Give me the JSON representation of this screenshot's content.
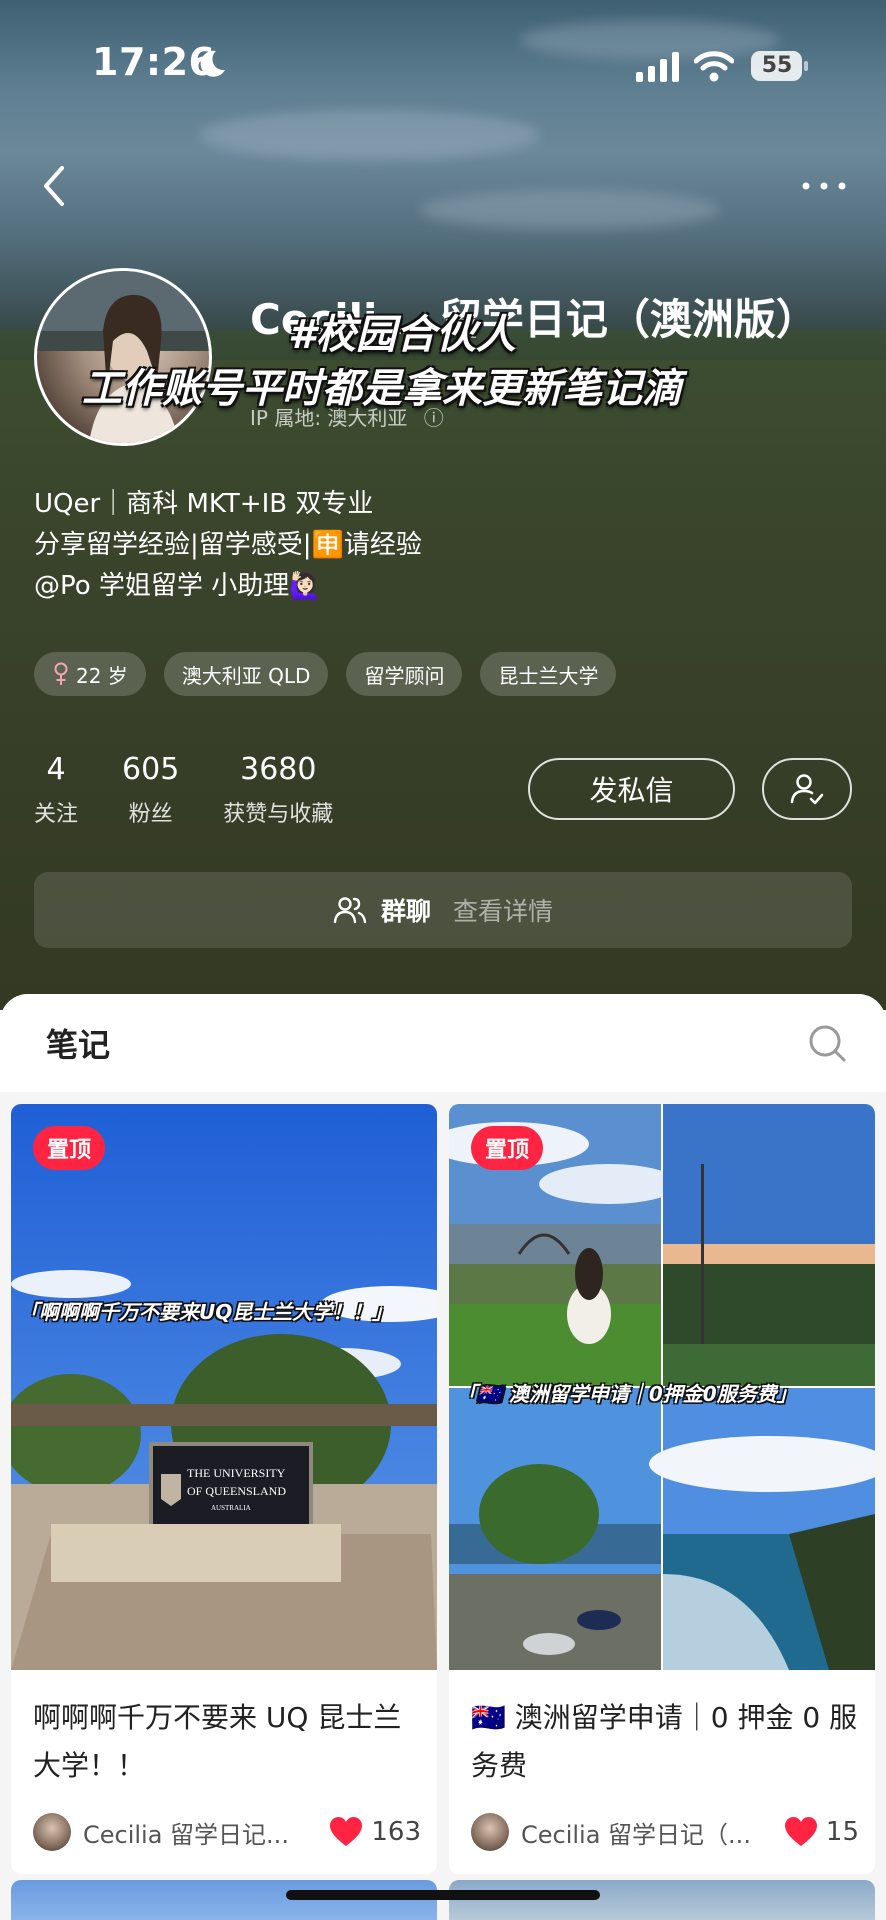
{
  "status_bar": {
    "time": "17:26",
    "battery": "55"
  },
  "profile": {
    "name": "Cecili... 留学日记（澳洲版）",
    "ip_location": "IP 属地: 澳大利亚",
    "overlay_line1": "#校园合伙人",
    "overlay_line2": "工作账号平时都是拿来更新笔记滴",
    "bio": [
      "UQer｜商科 MKT+IB 双专业",
      "分享留学经验|留学感受|🈸请经验",
      "@Po 学姐留学 小助理🙋🏻‍♀️"
    ],
    "tags": [
      {
        "label": "22 岁",
        "icon": "female-icon"
      },
      {
        "label": "澳大利亚 QLD"
      },
      {
        "label": "留学顾问"
      },
      {
        "label": "昆士兰大学"
      }
    ],
    "stats": [
      {
        "value": "4",
        "label": "关注"
      },
      {
        "value": "605",
        "label": "粉丝"
      },
      {
        "value": "3680",
        "label": "获赞与收藏"
      }
    ],
    "message_button": "发私信",
    "group_chat": {
      "label": "群聊",
      "detail": "查看详情"
    }
  },
  "notes": {
    "tab": "笔记",
    "cards": [
      {
        "pin": "置顶",
        "caption": "「啊啊啊千万不要来UQ昆士兰大学！！」",
        "sign_line1": "THE UNIVERSITY",
        "sign_line2": "OF QUEENSLAND",
        "sign_line3": "AUSTRALIA",
        "title": "啊啊啊千万不要来 UQ 昆士兰大学！！",
        "author": "Cecilia 留学日记...",
        "likes": "163"
      },
      {
        "pin": "置顶",
        "caption": "「🇦🇺 澳洲留学申请｜0押金0服务费」",
        "title": "🇦🇺 澳洲留学申请｜0 押金 0 服务费",
        "author": "Cecilia 留学日记（...",
        "likes": "15"
      }
    ]
  },
  "colors": {
    "accent": "#ff2442",
    "hero_bg": "#363d27"
  }
}
